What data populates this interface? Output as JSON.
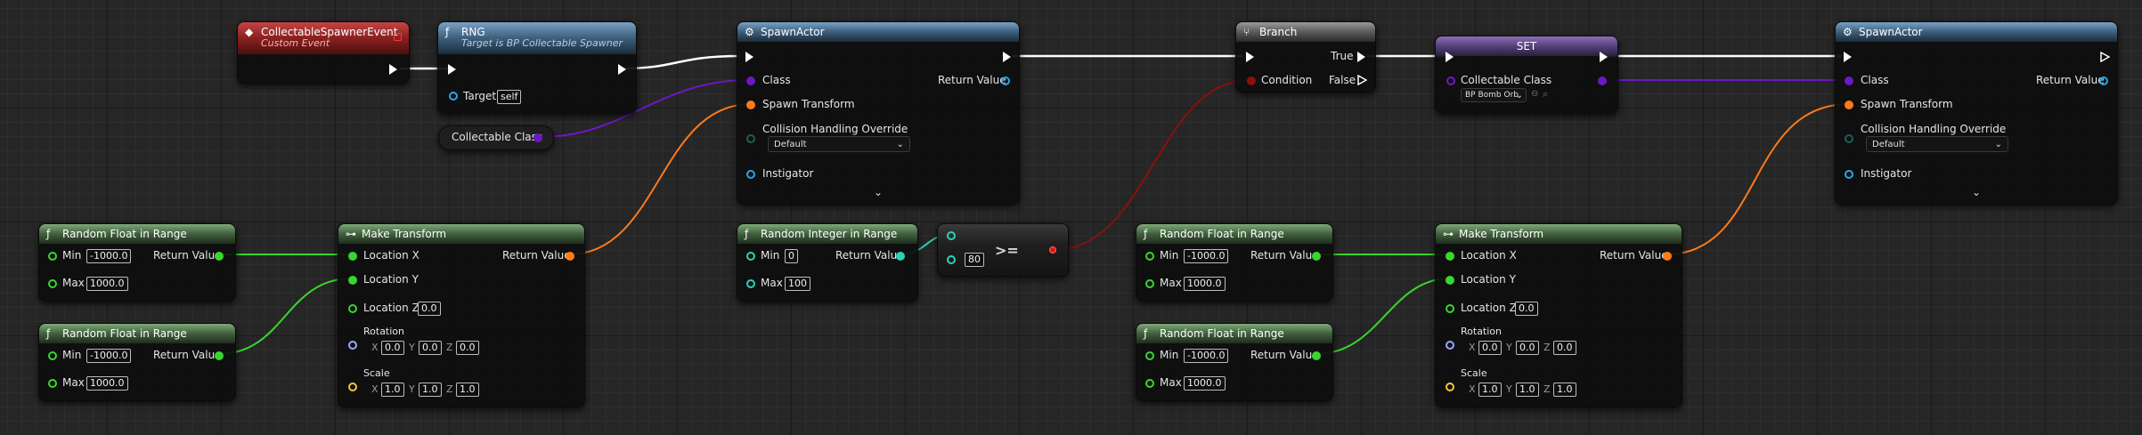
{
  "colors": {
    "exec": "#ffffff",
    "float_pin": "#39d62f",
    "int_pin": "#2ed1b5",
    "transform_pin": "#ff7a1a",
    "class_pin": "#6a19c2",
    "object_pin": "#2aa5e8",
    "bool_pin": "#8b0f0f",
    "rotator_pin": "#9aa7ff",
    "vector_pin": "#f2c83a"
  },
  "custom_event": {
    "title": "CollectableSpawnerEvent",
    "subtitle": "Custom Event",
    "icon": "event-diamond-icon"
  },
  "rng": {
    "title": "RNG",
    "subtitle": "Target is BP Collectable Spawner",
    "target_label": "Target",
    "target_value": "self"
  },
  "var_get": {
    "label": "Collectable Class"
  },
  "spawn_actor_1": {
    "title": "SpawnActor",
    "class_label": "Class",
    "return_label": "Return Value",
    "spawn_transform_label": "Spawn Transform",
    "collision_label": "Collision Handling Override",
    "collision_value": "Default",
    "instigator_label": "Instigator"
  },
  "branch": {
    "title": "Branch",
    "true_label": "True",
    "false_label": "False",
    "condition_label": "Condition"
  },
  "set_node": {
    "title": "SET",
    "var_label": "Collectable Class",
    "var_value": "BP Bomb Orb"
  },
  "spawn_actor_2": {
    "title": "SpawnActor",
    "class_label": "Class",
    "return_label": "Return Value",
    "spawn_transform_label": "Spawn Transform",
    "collision_label": "Collision Handling Override",
    "collision_value": "Default",
    "instigator_label": "Instigator"
  },
  "rand_float_1": {
    "title": "Random Float in Range",
    "min_label": "Min",
    "min_value": "-1000.0",
    "max_label": "Max",
    "max_value": "1000.0",
    "return_label": "Return Value"
  },
  "rand_float_2": {
    "title": "Random Float in Range",
    "min_label": "Min",
    "min_value": "-1000.0",
    "max_label": "Max",
    "max_value": "1000.0",
    "return_label": "Return Value"
  },
  "rand_float_3": {
    "title": "Random Float in Range",
    "min_label": "Min",
    "min_value": "-1000.0",
    "max_label": "Max",
    "max_value": "1000.0",
    "return_label": "Return Value"
  },
  "rand_float_4": {
    "title": "Random Float in Range",
    "min_label": "Min",
    "min_value": "-1000.0",
    "max_label": "Max",
    "max_value": "1000.0",
    "return_label": "Return Value"
  },
  "make_transform_1": {
    "title": "Make Transform",
    "loc_x": "Location X",
    "loc_y": "Location Y",
    "loc_z": "Location Z",
    "loc_z_value": "0.0",
    "return_label": "Return Value",
    "rotation_label": "Rotation",
    "scale_label": "Scale",
    "axis_x": "X",
    "axis_y": "Y",
    "axis_z": "Z",
    "rot_x": "0.0",
    "rot_y": "0.0",
    "rot_z": "0.0",
    "scale_x": "1.0",
    "scale_y": "1.0",
    "scale_z": "1.0"
  },
  "make_transform_2": {
    "title": "Make Transform",
    "loc_x": "Location X",
    "loc_y": "Location Y",
    "loc_z": "Location Z",
    "loc_z_value": "0.0",
    "return_label": "Return Value",
    "rotation_label": "Rotation",
    "scale_label": "Scale",
    "axis_x": "X",
    "axis_y": "Y",
    "axis_z": "Z",
    "rot_x": "0.0",
    "rot_y": "0.0",
    "rot_z": "0.0",
    "scale_x": "1.0",
    "scale_y": "1.0",
    "scale_z": "1.0"
  },
  "rand_int": {
    "title": "Random Integer in Range",
    "min_label": "Min",
    "min_value": "0",
    "max_label": "Max",
    "max_value": "100",
    "return_label": "Return Value"
  },
  "compare": {
    "operator": ">=",
    "b_value": "80"
  }
}
